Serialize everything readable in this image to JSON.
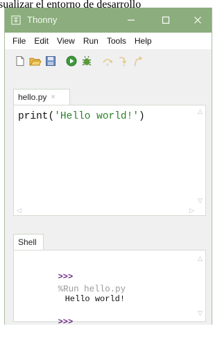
{
  "caption_text": "sualizar el entorno de desarrollo",
  "window": {
    "title": "Thonny"
  },
  "menu": [
    "File",
    "Edit",
    "View",
    "Run",
    "Tools",
    "Help"
  ],
  "toolbar": {
    "buttons": [
      "new-file-icon",
      "open-folder-icon",
      "save-icon",
      "run-icon",
      "debug-icon",
      "step-over-icon",
      "step-into-icon",
      "step-out-icon"
    ]
  },
  "editor": {
    "tab_label": "hello.py",
    "tab_close": "×",
    "code_pre": "print(",
    "code_str": "'Hello world!'",
    "code_post": ")"
  },
  "shell": {
    "tab_label": "Shell",
    "prompt": ">>>",
    "command": "%Run hello.py",
    "output": "Hello world!",
    "prompt2": ">>>"
  },
  "colors": {
    "titlebar": "#8cad7d",
    "prompt": "#6b2b83",
    "string": "#2a7f2a"
  }
}
